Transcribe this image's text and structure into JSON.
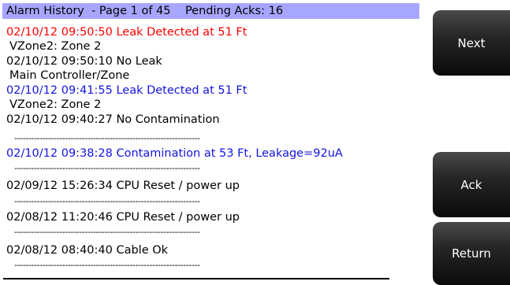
{
  "header": {
    "title": "Alarm History  - Page 1 of 45",
    "pending": "Pending Acks: 16"
  },
  "entries": [
    {
      "text": "02/10/12 09:50:50 Leak Detected at 51 Ft",
      "color": "#ff0000"
    },
    {
      "sub": "VZone2: Zone 2"
    },
    {
      "text": "02/10/12 09:50:10 No Leak",
      "color": "#000000"
    },
    {
      "sub": "Main Controller/Zone"
    },
    {
      "text": "02/10/12 09:41:55 Leak Detected at 51 Ft",
      "color": "#1414e0"
    },
    {
      "sub": "VZone2: Zone 2"
    },
    {
      "text": "02/10/12 09:40:27 No Contamination",
      "color": "#000000"
    },
    {
      "text": "02/10/12 09:38:28 Contamination at 53 Ft, Leakage=92uA",
      "color": "#1414e0"
    },
    {
      "text": "02/09/12 15:26:34 CPU Reset / power up",
      "color": "#000000"
    },
    {
      "text": "02/08/12 11:20:46 CPU Reset / power up",
      "color": "#000000"
    },
    {
      "text": "02/08/12 08:40:40 Cable Ok",
      "color": "#000000"
    }
  ],
  "separator": "------------------------------------------------------------------",
  "buttons": {
    "next": "Next",
    "ack": "Ack",
    "return": "Return"
  }
}
